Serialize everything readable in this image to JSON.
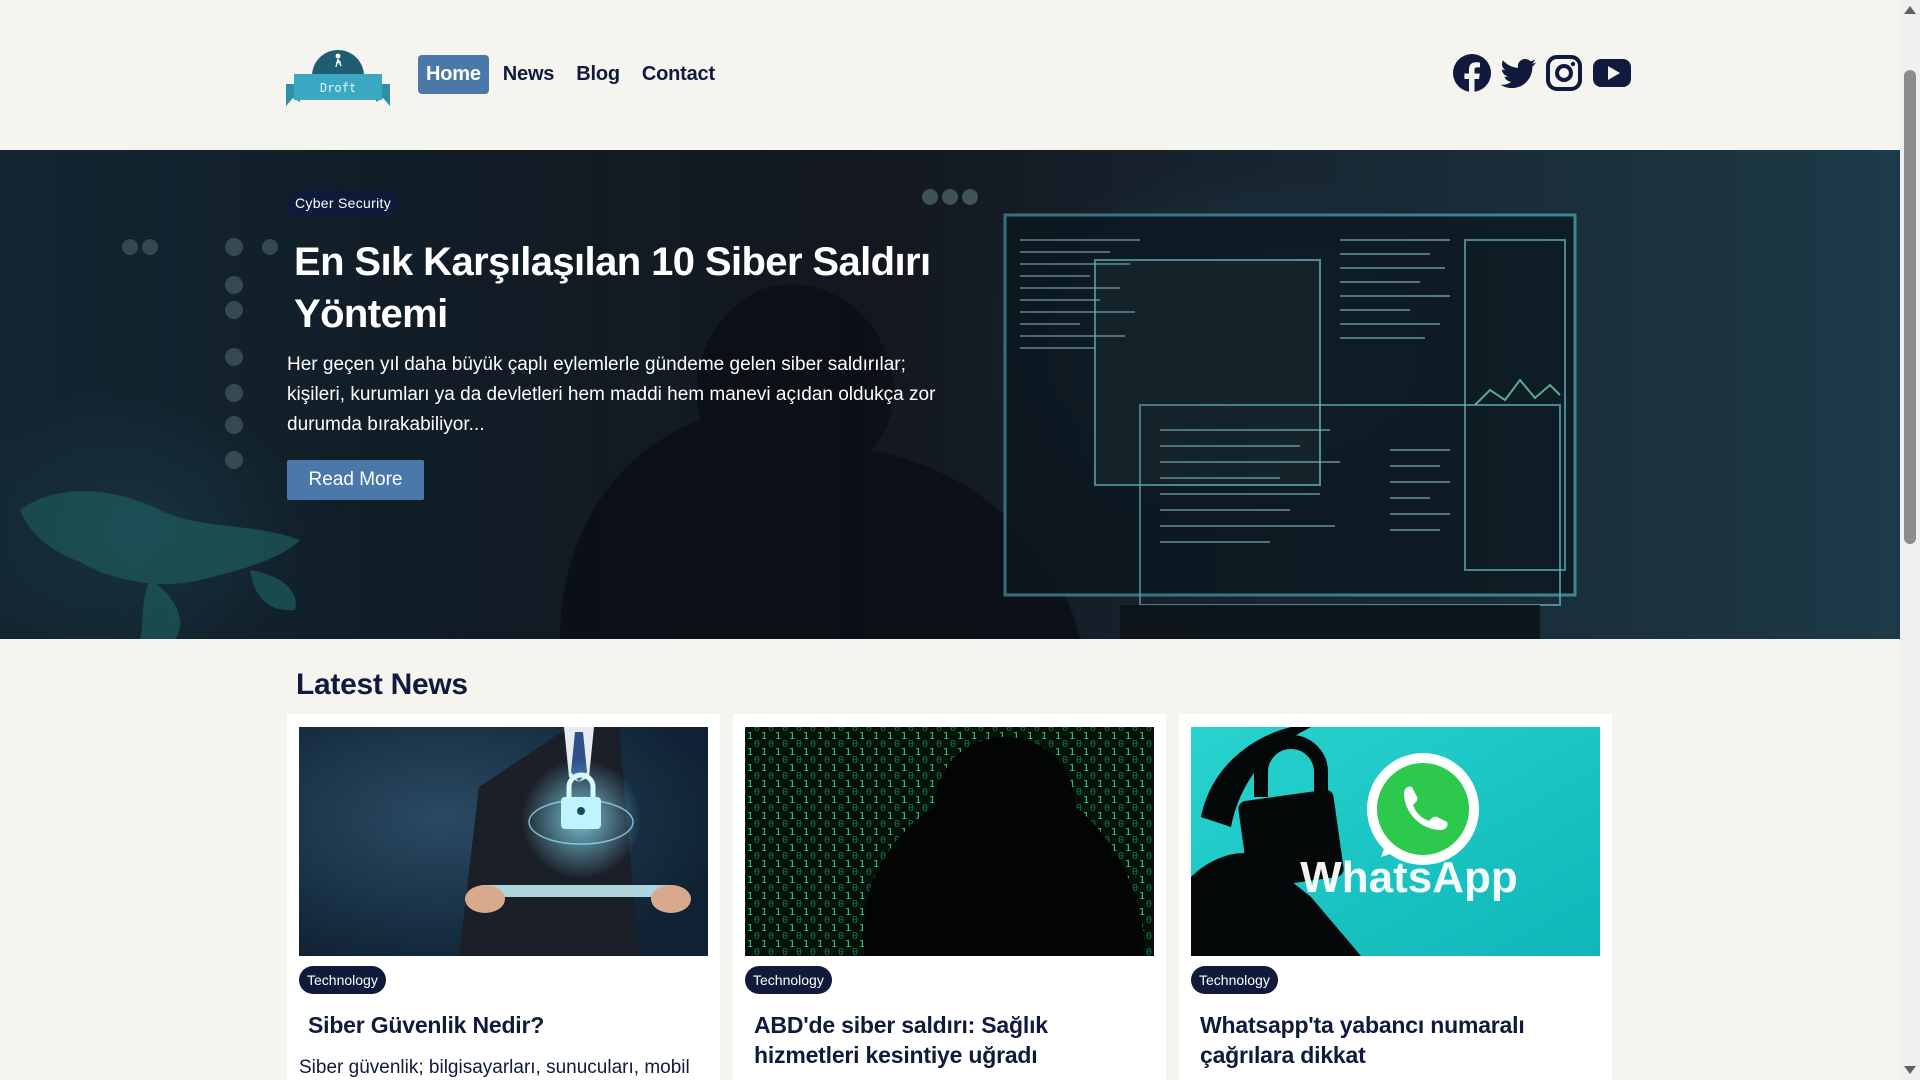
{
  "header": {
    "logo_text": "Droft",
    "nav": [
      {
        "label": "Home",
        "active": true
      },
      {
        "label": "News",
        "active": false
      },
      {
        "label": "Blog",
        "active": false
      },
      {
        "label": "Contact",
        "active": false
      }
    ],
    "social": [
      "facebook-icon",
      "twitter-icon",
      "instagram-icon",
      "youtube-icon"
    ]
  },
  "hero": {
    "category": "Cyber Security",
    "title": "En Sık Karşılaşılan 10 Siber Saldırı Yöntemi",
    "description": "Her geçen yıl daha büyük çaplı eylemlerle gündeme gelen siber saldırılar; kişileri, kurumları ya da devletleri hem maddi hem manevi açıdan oldukça zor durumda bırakabiliyor...",
    "button_label": "Read More"
  },
  "latest": {
    "title": "Latest News",
    "cards": [
      {
        "tag": "Technology",
        "title": "Siber Güvenlik Nedir?",
        "excerpt": "Siber güvenlik; bilgisayarları, sunucuları, mobil"
      },
      {
        "tag": "Technology",
        "title": "ABD'de siber saldırı: Sağlık hizmetleri kesintiye uğradı",
        "excerpt": ""
      },
      {
        "tag": "Technology",
        "title": "Whatsapp'ta yabancı numaralı çağrılara dikkat",
        "excerpt": "",
        "image_text": "WhatsApp"
      }
    ]
  },
  "colors": {
    "page_bg": "#f6f4ee",
    "navy": "#0f1a3d",
    "accent_blue": "#4a78a8",
    "badge_bg": "#101a3a",
    "whatsapp_teal": "#12c6c2"
  }
}
